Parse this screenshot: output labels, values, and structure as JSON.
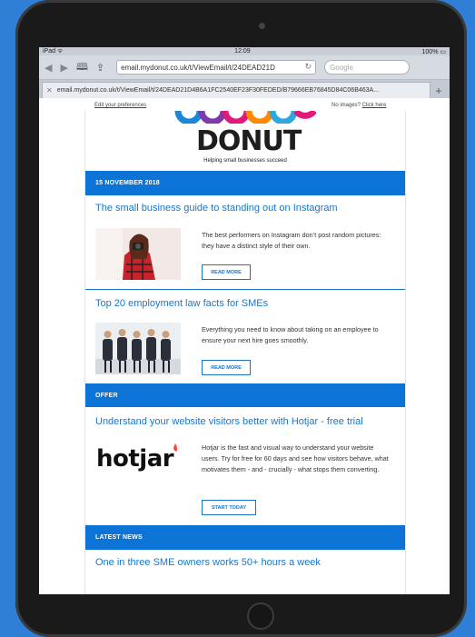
{
  "browser": {
    "status_left": "iPad ᯤ",
    "status_time": "12:09",
    "status_right": "100% ▭",
    "url": "email.mydonut.co.uk/t/ViewEmail/t/24DEAD21D",
    "search_placeholder": "Google",
    "tab_title": "email.mydonut.co.uk/t/ViewEmail/t/24DEAD21D4B6A1FC2540EF23F30FEDED/B79666EB76845D84C06B463A..."
  },
  "email": {
    "edit_prefs": "Edit your preferences",
    "no_images_label": "No images?",
    "no_images_link": "Click here",
    "logo_text": "DONUT",
    "logo_tagline": "Helping small businesses succeed",
    "date_bar": "15 NOVEMBER 2018",
    "article1": {
      "title": "The small business guide to standing out on Instagram",
      "desc": "The best performers on Instagram don’t post random pictures: they have a distinct style of their own.",
      "button": "READ MORE"
    },
    "article2": {
      "title": "Top 20 employment law facts for SMEs",
      "desc": "Everything you need to know about taking on an employee to ensure your next hire goes smoothly.",
      "button": "READ MORE"
    },
    "offer_bar": "OFFER",
    "offer": {
      "title": "Understand your website visitors better with Hotjar - free trial",
      "logo": "hotjar",
      "desc": "Hotjar is the fast and visual way to understand your website users. Try for free for 60 days and see how visitors behave, what motivates them - and - crucially - what stops them converting.",
      "button": "START TODAY"
    },
    "news_bar": "LATEST NEWS",
    "news_title": "One in three SME owners works 50+ hours a week"
  },
  "colors": {
    "brand_blue": "#0b74d6",
    "link_blue": "#1877c9"
  }
}
